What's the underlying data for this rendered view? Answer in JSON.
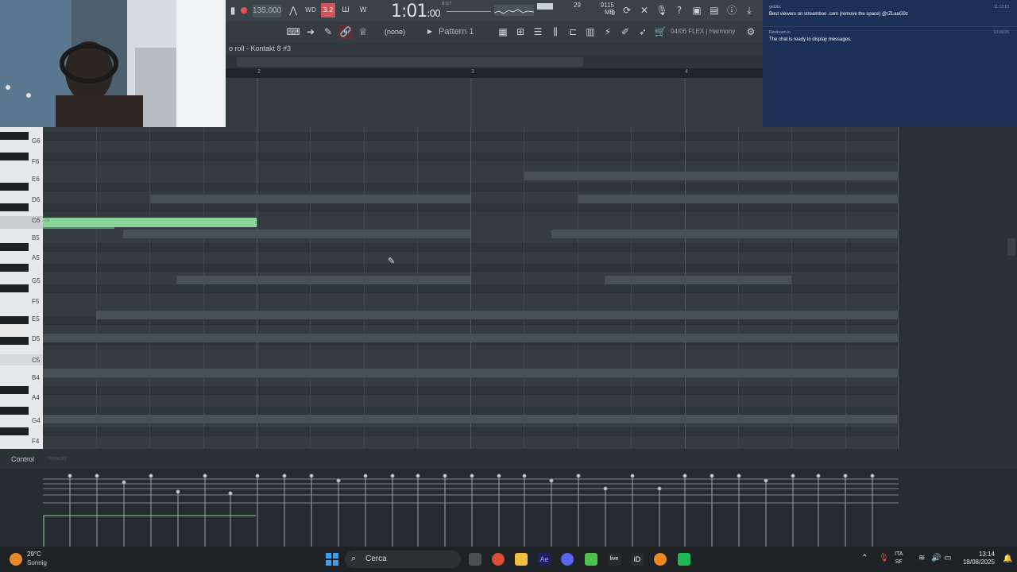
{
  "toolbar": {
    "tempo": "135.000",
    "time_main": "1:01",
    "time_sub": ":00",
    "time_label": "B:S:T",
    "cpu": "29",
    "memory": "9115 MB",
    "memory_sub": "0",
    "snap": "(none)",
    "pattern": "Pattern 1",
    "flex_info": "04/06 FLEX | Harmony",
    "rec_level": "3.2"
  },
  "pianoroll": {
    "breadcrumb": "o roll - Kontakt 8 #3",
    "ruler_marks": [
      "2",
      "3",
      "4"
    ],
    "key_labels": [
      "G6",
      "F6",
      "E6",
      "D6",
      "C6",
      "B5",
      "A5",
      "G5",
      "F5",
      "E5",
      "D5",
      "C5",
      "B4",
      "A4",
      "G4",
      "F4"
    ],
    "selected_note_label": "C6"
  },
  "control": {
    "label": "Control",
    "sublabel": "Velocity"
  },
  "chat": {
    "messages": [
      {
        "user": "getbbc",
        "time": "11:12:13",
        "text": "Best viewers on streamboo .com (remove the space) @rZLaaG9z"
      },
      {
        "user": "Restream.io",
        "time": "13:09:05",
        "text": "The chat is ready to display messages."
      }
    ]
  },
  "taskbar": {
    "weather_temp": "29°C",
    "weather_cond": "Sonnig",
    "search_placeholder": "Cerca",
    "lang_top": "ITA",
    "lang_bottom": "SF",
    "time": "13:14",
    "date": "18/08/2025"
  },
  "colors": {
    "note": "#8bd49a",
    "chat_bg": "#1b2f57",
    "grid_bg": "#343c40"
  }
}
